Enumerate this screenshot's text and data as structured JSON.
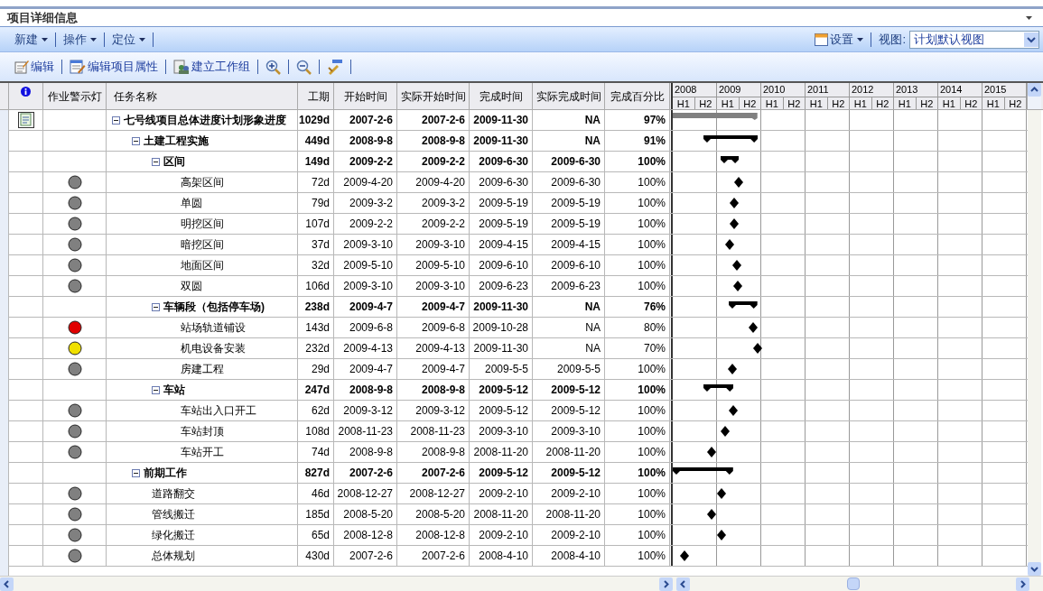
{
  "panel": {
    "title": "项目详细信息"
  },
  "menu_bar": {
    "menus": [
      "新建",
      "操作",
      "定位"
    ],
    "settings": "设置",
    "view_label": "视图:",
    "view_value": "计划默认视图"
  },
  "toolbar": {
    "buttons": [
      {
        "kind": "edit",
        "label": "编辑"
      },
      {
        "kind": "properties",
        "label": "编辑项目属性"
      },
      {
        "kind": "group",
        "label": "建立工作组"
      },
      {
        "kind": "zoom-in"
      },
      {
        "kind": "zoom-out"
      },
      {
        "kind": "tools"
      }
    ]
  },
  "table": {
    "columns": [
      "作业警示灯",
      "任务名称",
      "工期",
      "开始时间",
      "实际开始时间",
      "完成时间",
      "实际完成时间",
      "完成百分比"
    ],
    "gantt_years": [
      {
        "year": "2008",
        "halves": [
          "H1",
          "H2"
        ]
      },
      {
        "year": "2009",
        "halves": [
          "H1",
          "H2"
        ]
      },
      {
        "year": "2010",
        "halves": [
          "H1",
          "H2"
        ]
      },
      {
        "year": "2011",
        "halves": [
          "H1",
          "H2"
        ]
      },
      {
        "year": "2012",
        "halves": [
          "H1",
          "H2"
        ]
      },
      {
        "year": "2013",
        "halves": [
          "H1",
          "H2"
        ]
      },
      {
        "year": "2014",
        "halves": [
          "H1",
          "H2"
        ]
      },
      {
        "year": "2015",
        "halves": [
          "H1",
          "H2"
        ]
      }
    ],
    "rows": [
      {
        "kind": "root",
        "name": "七号线项目总体进度计划形象进度",
        "expanded": true,
        "duration": "1029d",
        "start": "2007-2-6",
        "actual_start": "2007-2-6",
        "finish": "2009-11-30",
        "actual_finish": "NA",
        "percent": "97%",
        "children": [
          {
            "kind": "summary",
            "name": "土建工程实施",
            "expanded": true,
            "duration": "449d",
            "start": "2008-9-8",
            "actual_start": "2008-9-8",
            "finish": "2009-11-30",
            "actual_finish": "NA",
            "percent": "91%",
            "children": [
              {
                "kind": "summary",
                "name": "区间",
                "expanded": true,
                "duration": "149d",
                "start": "2009-2-2",
                "actual_start": "2009-2-2",
                "finish": "2009-6-30",
                "actual_finish": "2009-6-30",
                "percent": "100%",
                "children": [
                  {
                    "kind": "task",
                    "color": "#808080",
                    "name": "高架区间",
                    "duration": "72d",
                    "start": "2009-4-20",
                    "actual_start": "2009-4-20",
                    "finish": "2009-6-30",
                    "actual_finish": "2009-6-30",
                    "percent": "100%"
                  },
                  {
                    "kind": "task",
                    "color": "#808080",
                    "name": "单圆",
                    "duration": "79d",
                    "start": "2009-3-2",
                    "actual_start": "2009-3-2",
                    "finish": "2009-5-19",
                    "actual_finish": "2009-5-19",
                    "percent": "100%"
                  },
                  {
                    "kind": "task",
                    "color": "#808080",
                    "name": "明挖区间",
                    "duration": "107d",
                    "start": "2009-2-2",
                    "actual_start": "2009-2-2",
                    "finish": "2009-5-19",
                    "actual_finish": "2009-5-19",
                    "percent": "100%"
                  },
                  {
                    "kind": "task",
                    "color": "#808080",
                    "name": "暗挖区间",
                    "duration": "37d",
                    "start": "2009-3-10",
                    "actual_start": "2009-3-10",
                    "finish": "2009-4-15",
                    "actual_finish": "2009-4-15",
                    "percent": "100%"
                  },
                  {
                    "kind": "task",
                    "color": "#808080",
                    "name": "地面区间",
                    "duration": "32d",
                    "start": "2009-5-10",
                    "actual_start": "2009-5-10",
                    "finish": "2009-6-10",
                    "actual_finish": "2009-6-10",
                    "percent": "100%"
                  },
                  {
                    "kind": "task",
                    "color": "#808080",
                    "name": "双圆",
                    "duration": "106d",
                    "start": "2009-3-10",
                    "actual_start": "2009-3-10",
                    "finish": "2009-6-23",
                    "actual_finish": "2009-6-23",
                    "percent": "100%"
                  }
                ]
              },
              {
                "kind": "summary",
                "name": "车辆段（包括停车场)",
                "expanded": true,
                "duration": "238d",
                "start": "2009-4-7",
                "actual_start": "2009-4-7",
                "finish": "2009-11-30",
                "actual_finish": "NA",
                "percent": "76%",
                "children": [
                  {
                    "kind": "task",
                    "color": "#e00000",
                    "name": "站场轨道铺设",
                    "duration": "143d",
                    "start": "2009-6-8",
                    "actual_start": "2009-6-8",
                    "finish": "2009-10-28",
                    "actual_finish": "NA",
                    "percent": "80%"
                  },
                  {
                    "kind": "task",
                    "color": "#f0e000",
                    "name": "机电设备安装",
                    "duration": "232d",
                    "start": "2009-4-13",
                    "actual_start": "2009-4-13",
                    "finish": "2009-11-30",
                    "actual_finish": "NA",
                    "percent": "70%"
                  },
                  {
                    "kind": "task",
                    "color": "#808080",
                    "name": "房建工程",
                    "duration": "29d",
                    "start": "2009-4-7",
                    "actual_start": "2009-4-7",
                    "finish": "2009-5-5",
                    "actual_finish": "2009-5-5",
                    "percent": "100%"
                  }
                ]
              },
              {
                "kind": "summary",
                "name": "车站",
                "expanded": true,
                "duration": "247d",
                "start": "2008-9-8",
                "actual_start": "2008-9-8",
                "finish": "2009-5-12",
                "actual_finish": "2009-5-12",
                "percent": "100%",
                "children": [
                  {
                    "kind": "task",
                    "color": "#808080",
                    "name": "车站出入口开工",
                    "duration": "62d",
                    "start": "2009-3-12",
                    "actual_start": "2009-3-12",
                    "finish": "2009-5-12",
                    "actual_finish": "2009-5-12",
                    "percent": "100%"
                  },
                  {
                    "kind": "task",
                    "color": "#808080",
                    "name": "车站封顶",
                    "duration": "108d",
                    "start": "2008-11-23",
                    "actual_start": "2008-11-23",
                    "finish": "2009-3-10",
                    "actual_finish": "2009-3-10",
                    "percent": "100%"
                  },
                  {
                    "kind": "task",
                    "color": "#808080",
                    "name": "车站开工",
                    "duration": "74d",
                    "start": "2008-9-8",
                    "actual_start": "2008-9-8",
                    "finish": "2008-11-20",
                    "actual_finish": "2008-11-20",
                    "percent": "100%"
                  }
                ]
              }
            ]
          },
          {
            "kind": "summary",
            "name": "前期工作",
            "expanded": true,
            "duration": "827d",
            "start": "2007-2-6",
            "actual_start": "2007-2-6",
            "finish": "2009-5-12",
            "actual_finish": "2009-5-12",
            "percent": "100%",
            "children": [
              {
                "kind": "task",
                "color": "#808080",
                "name": "道路翻交",
                "duration": "46d",
                "start": "2008-12-27",
                "actual_start": "2008-12-27",
                "finish": "2009-2-10",
                "actual_finish": "2009-2-10",
                "percent": "100%"
              },
              {
                "kind": "task",
                "color": "#808080",
                "name": "管线搬迁",
                "duration": "185d",
                "start": "2008-5-20",
                "actual_start": "2008-5-20",
                "finish": "2008-11-20",
                "actual_finish": "2008-11-20",
                "percent": "100%"
              },
              {
                "kind": "task",
                "color": "#808080",
                "name": "绿化搬迁",
                "duration": "65d",
                "start": "2008-12-8",
                "actual_start": "2008-12-8",
                "finish": "2009-2-10",
                "actual_finish": "2009-2-10",
                "percent": "100%"
              },
              {
                "kind": "task",
                "color": "#808080",
                "name": "总体规划",
                "duration": "430d",
                "start": "2007-2-6",
                "actual_start": "2007-2-6",
                "finish": "2008-4-10",
                "actual_finish": "2008-4-10",
                "percent": "100%"
              }
            ]
          }
        ]
      }
    ]
  }
}
